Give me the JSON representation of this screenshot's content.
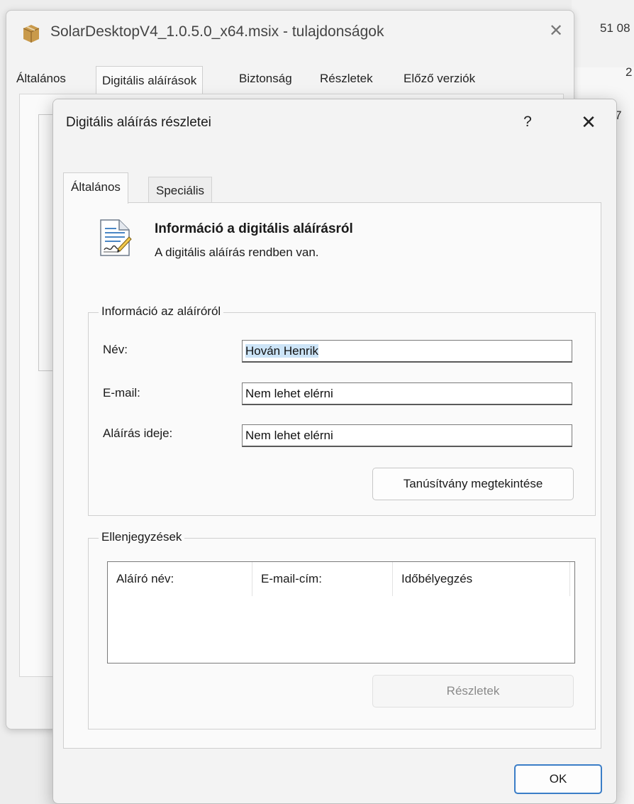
{
  "background": {
    "values": [
      "51 08",
      "2",
      "50 57"
    ]
  },
  "parent_window": {
    "title": "SolarDesktopV4_1.0.5.0_x64.msix - tulajdonságok",
    "tabs": [
      {
        "label": "Általános"
      },
      {
        "label": "Digitális aláírások"
      },
      {
        "label": "Biztonság"
      },
      {
        "label": "Részletek"
      },
      {
        "label": "Előző verziók"
      }
    ],
    "active_tab": "Digitális aláírások"
  },
  "dialog": {
    "title": "Digitális aláírás részletei",
    "help_label": "?",
    "tabs": [
      {
        "label": "Általános"
      },
      {
        "label": "Speciális"
      }
    ],
    "active_tab": "Általános",
    "info": {
      "title": "Információ a digitális aláírásról",
      "status": "A digitális aláírás rendben van."
    },
    "signer_group": {
      "legend": "Információ az aláíróról",
      "fields": [
        {
          "label": "Név:",
          "value": "Hován Henrik"
        },
        {
          "label": "E-mail:",
          "value": "Nem lehet elérni"
        },
        {
          "label": "Aláírás ideje:",
          "value": "Nem lehet elérni"
        }
      ],
      "view_cert_button": "Tanúsítvány megtekintése"
    },
    "countersign_group": {
      "legend": "Ellenjegyzések",
      "columns": [
        "Aláíró név:",
        "E-mail-cím:",
        "Időbélyegzés"
      ],
      "rows": [],
      "details_button": "Részletek"
    },
    "ok_button": "OK"
  },
  "colors": {
    "selection": "#cce4f7",
    "ok_border": "#3a7dc7",
    "package_icon": "#b98a3e"
  }
}
